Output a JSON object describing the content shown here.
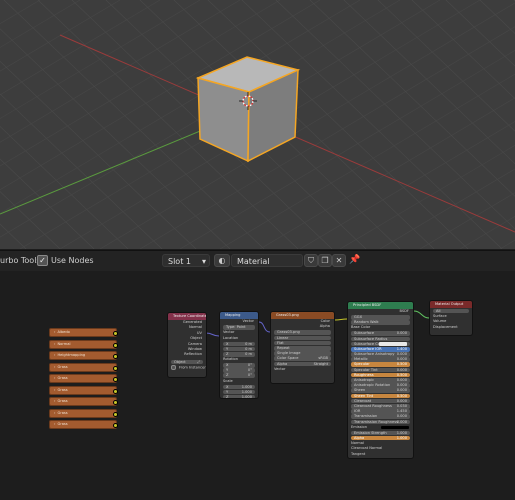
{
  "header": {
    "tools_label": "urbo Tools",
    "use_nodes_label": "Use Nodes",
    "use_nodes_checked": "✓",
    "slot_label": "Slot 1",
    "material_name": "Material"
  },
  "nodes": {
    "texture_coordinate": {
      "title": "Texture Coordinate",
      "outputs": [
        "Generated",
        "Normal",
        "UV",
        "Object",
        "Camera",
        "Window",
        "Reflection"
      ],
      "object_label": "Object",
      "from_instancer": "From Instancer"
    },
    "mapping": {
      "title": "Mapping",
      "output": "Vector",
      "type_label": "Type:",
      "type_value": "Point",
      "vector_label": "Vector",
      "location_label": "Location",
      "location": [
        [
          "X",
          "0 m"
        ],
        [
          "Y",
          "0 m"
        ],
        [
          "Z",
          "0 m"
        ]
      ],
      "rotation_label": "Rotation",
      "rotation": [
        [
          "X",
          "0°"
        ],
        [
          "Y",
          "0°"
        ],
        [
          "Z",
          "0°"
        ]
      ],
      "scale_label": "Scale",
      "scale": [
        [
          "X",
          "1.000"
        ],
        [
          "Y",
          "1.000"
        ],
        [
          "Z",
          "1.000"
        ]
      ]
    },
    "image_texture": {
      "title": "Grass03.png",
      "outputs": [
        "Color",
        "Alpha"
      ],
      "image": "Grass03.png",
      "interpolation": "Linear",
      "projection": "Flat",
      "extension": "Repeat",
      "source": "Single Image",
      "color_space_label": "Color Space",
      "color_space": "sRGB",
      "alpha_label": "Alpha",
      "alpha": "Straight",
      "vector_label": "Vector"
    },
    "principled": {
      "title": "Principled BSDF",
      "output": "BSDF",
      "distribution": "GGX",
      "subsurface_method": "Random Walk",
      "rows": [
        [
          "Base Color",
          ""
        ],
        [
          "Subsurface",
          "0.000"
        ],
        [
          "Subsurface Radius",
          ""
        ],
        [
          "Subsurface Color",
          ""
        ],
        [
          "Subsurface IOR",
          "1.400"
        ],
        [
          "Subsurface Anisotropy",
          "0.000"
        ],
        [
          "Metallic",
          "0.000"
        ],
        [
          "Specular",
          "0.500"
        ],
        [
          "Specular Tint",
          "0.000"
        ],
        [
          "Roughness",
          "0.500"
        ],
        [
          "Anisotropic",
          "0.000"
        ],
        [
          "Anisotropic Rotation",
          "0.000"
        ],
        [
          "Sheen",
          "0.000"
        ],
        [
          "Sheen Tint",
          "0.500"
        ],
        [
          "Clearcoat",
          "0.000"
        ],
        [
          "Clearcoat Roughness",
          "0.030"
        ],
        [
          "IOR",
          "1.450"
        ],
        [
          "Transmission",
          "0.000"
        ],
        [
          "Transmission Roughness",
          "0.000"
        ],
        [
          "Emission",
          ""
        ],
        [
          "Emission Strength",
          "1.000"
        ],
        [
          "Alpha",
          "1.000"
        ],
        [
          "Normal",
          ""
        ],
        [
          "Clearcoat Normal",
          ""
        ],
        [
          "Tangent",
          ""
        ]
      ]
    },
    "material_output": {
      "title": "Material Output",
      "target": "All",
      "inputs": [
        "Surface",
        "Volume",
        "Displacement"
      ]
    }
  },
  "texture_nodes": [
    "Albedo",
    "Normal",
    "Heightmapping",
    "Grass",
    "Grass",
    "Grass",
    "Grass",
    "Grass",
    "Grass"
  ],
  "colors": {
    "selection": "#f5a623",
    "x_axis": "#b04444",
    "y_axis": "#5a9a3e",
    "node_header_input": "#83314a",
    "node_header_vector": "#3c5a8a",
    "node_header_texture": "#8a4b24",
    "node_header_shader": "#2e7d4f",
    "node_header_output": "#7a2a2a"
  }
}
